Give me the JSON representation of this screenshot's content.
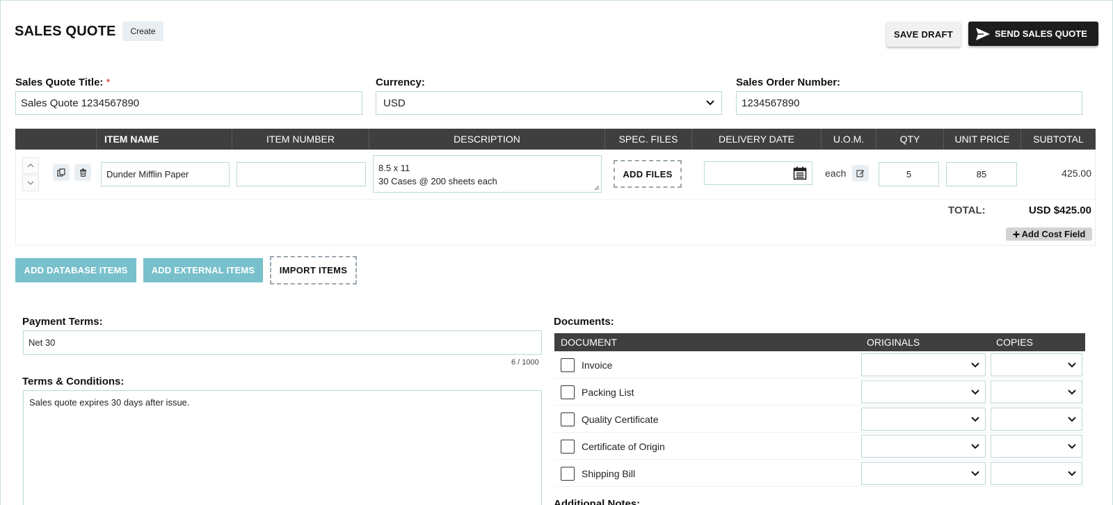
{
  "header": {
    "title": "SALES QUOTE",
    "mode_badge": "Create",
    "save_draft_label": "SAVE DRAFT",
    "send_label": "SEND SALES QUOTE"
  },
  "form": {
    "title_label": "Sales Quote Title:",
    "required_mark": "*",
    "title_value": "Sales Quote 1234567890",
    "currency_label": "Currency:",
    "currency_value": "USD",
    "order_label": "Sales Order Number:",
    "order_value": "1234567890"
  },
  "items_table": {
    "headers": [
      "ITEM NAME",
      "ITEM NUMBER",
      "DESCRIPTION",
      "SPEC. FILES",
      "DELIVERY DATE",
      "U.O.M.",
      "QTY",
      "UNIT PRICE",
      "SUBTOTAL"
    ],
    "rows": [
      {
        "item_name": "Dunder Mifflin Paper",
        "item_number": "",
        "description_line1": "8.5 x 11",
        "description_line2": "30 Cases @ 200 sheets each",
        "spec_files_button": "ADD FILES",
        "delivery_date": "",
        "uom": "each",
        "qty": "5",
        "unit_price": "85",
        "subtotal": "425.00"
      }
    ],
    "total_label": "TOTAL:",
    "total_value": "USD $425.00",
    "add_cost_label": "Add Cost Field"
  },
  "item_actions": {
    "add_database": "ADD DATABASE ITEMS",
    "add_external": "ADD EXTERNAL ITEMS",
    "import": "IMPORT ITEMS"
  },
  "payment": {
    "label": "Payment Terms:",
    "value": "Net 30",
    "counter": "6 / 1000"
  },
  "terms": {
    "label": "Terms & Conditions:",
    "value": "Sales quote expires 30 days after issue."
  },
  "documents": {
    "label": "Documents:",
    "headers": [
      "DOCUMENT",
      "ORIGINALS",
      "COPIES"
    ],
    "rows": [
      "Invoice",
      "Packing List",
      "Quality Certificate",
      "Certificate of Origin",
      "Shipping Bill"
    ]
  },
  "additional_notes_label": "Additional Notes:",
  "colors": {
    "header_bg": "#3f3f3f",
    "teal_button": "#78c0cc",
    "send_button": "#1d1d1d",
    "input_border": "#bcd8d8",
    "required": "#d9302c"
  }
}
